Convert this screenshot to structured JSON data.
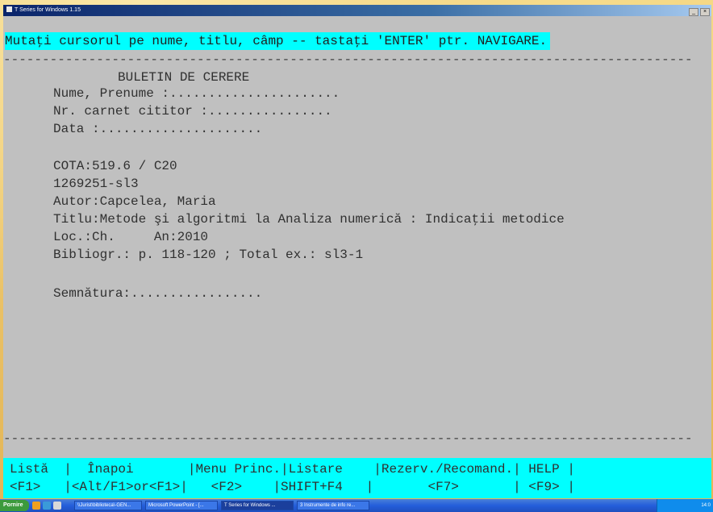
{
  "window": {
    "title": "T Series for Windows 1.15",
    "controls": {
      "restore": "_",
      "close": "×"
    }
  },
  "screen": {
    "hint": "Mutaţi cursorul pe nume, titlu, câmp -- tastaţi 'ENTER' ptr. NAVIGARE.",
    "separator": "-----------------------------------------------------------------------------------------",
    "form": {
      "heading": "BULETIN DE CERERE",
      "name_line": "Nume, Prenume :......................",
      "card_line": "Nr. carnet cititor :................",
      "date_line": "Data :.....................",
      "cota": "COTA:519.6 / C20",
      "inventory": "1269251-sl3",
      "author": "Autor:Capcelea, Maria",
      "title": "Titlu:Metode şi algoritmi la Analiza numerică : Indicaţii metodice",
      "place_year": "Loc.:Ch.     An:2010",
      "biblio": "Bibliogr.: p. 118-120 ; Total ex.: sl3-1",
      "signature": "Semnătura:................."
    }
  },
  "function_keys": {
    "row1": "Listă  |  Înapoi       |Menu Princ.|Listare    |Rezerv./Recomand.| HELP |",
    "row2": "<F1>   |<Alt/F1>or<F1>|   <F2>    |SHIFT+F4   |       <F7>       | <F9> |",
    "items": [
      {
        "label": "Listă",
        "key": "<F1>"
      },
      {
        "label": "Înapoi",
        "key": "<Alt/F1>or<F1>"
      },
      {
        "label": "Menu Princ.",
        "key": "<F2>"
      },
      {
        "label": "Listare",
        "key": "SHIFT+F4"
      },
      {
        "label": "Rezerv./Recomand.",
        "key": "<F7>"
      },
      {
        "label": "HELP",
        "key": "<F9>"
      }
    ]
  },
  "taskbar": {
    "start": "Pornire",
    "tasks": [
      "\\\\Jurist\\biblioteca\\-GEN...",
      "Microsoft PowerPoint - [...",
      "T Series for Windows ...",
      "3 Instrumente de info re..."
    ],
    "clock": "14:0"
  },
  "colors": {
    "terminal_bg": "#c0c0c0",
    "highlight": "#00ffff",
    "text": "#303030",
    "titlebar": "#0a246a",
    "taskbar": "#245edb"
  }
}
